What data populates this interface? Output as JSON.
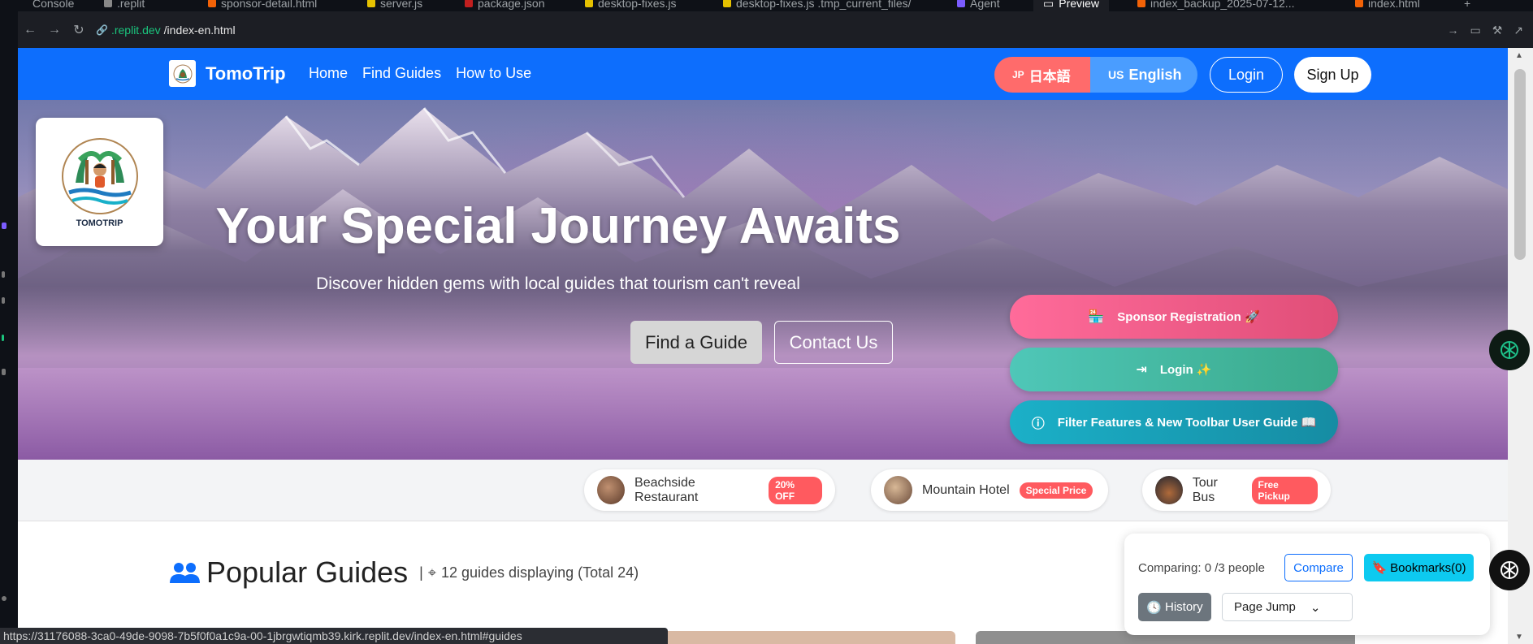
{
  "ide": {
    "tabs": [
      "Console",
      ".replit",
      "sponsor-detail.html",
      "server.js",
      "package.json",
      "desktop-fixes.js",
      "desktop-fixes.js .tmp_current_files/",
      "Agent",
      "Preview",
      "index_backup_2025-07-12...",
      "index.html"
    ],
    "url_host": ".replit.dev",
    "url_path": "/index-en.html",
    "status_url": "https://31176088-3ca0-49de-9098-7b5f0f0a1c9a-00-1jbrgwtiqmb39.kirk.replit.dev/index-en.html#guides"
  },
  "navbar": {
    "brand": "TomoTrip",
    "links": [
      "Home",
      "Find Guides",
      "How to Use"
    ],
    "lang_jp_code": "JP",
    "lang_jp": "日本語",
    "lang_en_code": "US",
    "lang_en": "English",
    "login": "Login",
    "signup": "Sign Up"
  },
  "hero": {
    "logo_text": "TOMOTRIP",
    "title": "Your Special Journey Awaits",
    "subtitle": "Discover hidden gems with local guides that tourism can't reveal",
    "find_button": "Find a Guide",
    "contact_button": "Contact Us"
  },
  "floating_actions": {
    "sponsor": "Sponsor Registration 🚀",
    "login": "Login ✨",
    "guide": "Filter Features & New Toolbar User Guide 📖"
  },
  "sponsors": [
    {
      "name": "Beachside Restaurant",
      "badge": "20% OFF"
    },
    {
      "name": "Mountain Hotel",
      "badge": "Special Price"
    },
    {
      "name": "Tour Bus",
      "badge": "Free Pickup"
    }
  ],
  "guides": {
    "title": "Popular Guides",
    "meta": "12 guides displaying (Total 24)"
  },
  "compare": {
    "label": "Comparing: 0 /3 people",
    "compare_button": "Compare",
    "bookmarks_button": "Bookmarks(0)",
    "history_button": "History",
    "page_jump": "Page Jump"
  }
}
